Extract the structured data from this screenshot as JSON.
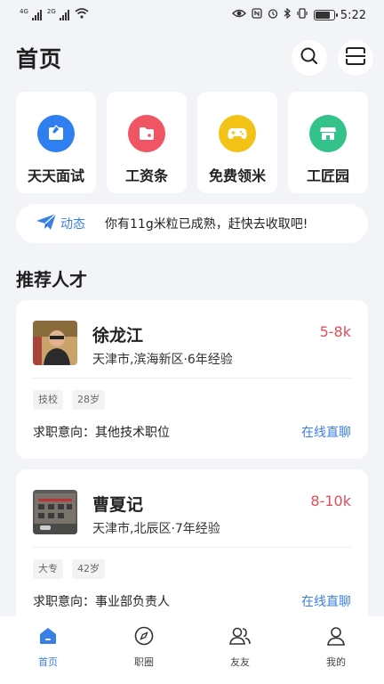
{
  "status_bar": {
    "sim1_tag": "4G",
    "sim2_tag": "2G",
    "time": "5:22",
    "battery_level": 0.8
  },
  "header": {
    "title": "首页"
  },
  "quick_tiles": [
    {
      "label": "天天面试",
      "icon": "interview-icon",
      "color": "#2f7ff0"
    },
    {
      "label": "工资条",
      "icon": "folder-icon",
      "color": "#ef5562"
    },
    {
      "label": "免费领米",
      "icon": "gamepad-icon",
      "color": "#f2c316"
    },
    {
      "label": "工匠园",
      "icon": "store-icon",
      "color": "#33c28a"
    }
  ],
  "notice": {
    "tag": "动态",
    "text": "你有11g米粒已成熟，赶快去收取吧!"
  },
  "section_title": "推荐人才",
  "candidates": [
    {
      "name": "徐龙江",
      "info": "天津市,滨海新区·6年经验",
      "salary": "5-8k",
      "tags": [
        "技校",
        "28岁"
      ],
      "intent": "求职意向：其他技术职位",
      "chat_label": "在线直聊"
    },
    {
      "name": "曹夏记",
      "info": "天津市,北辰区·7年经验",
      "salary": "8-10k",
      "tags": [
        "大专",
        "42岁"
      ],
      "intent": "求职意向：事业部负责人",
      "chat_label": "在线直聊"
    }
  ],
  "tab_bar": [
    {
      "label": "首页",
      "icon": "home-icon",
      "active": true
    },
    {
      "label": "职圈",
      "icon": "compass-icon",
      "active": false
    },
    {
      "label": "友友",
      "icon": "friends-icon",
      "active": false
    },
    {
      "label": "我的",
      "icon": "profile-icon",
      "active": false
    }
  ],
  "colors": {
    "accent": "#3a7fe6",
    "salary": "#e34d59",
    "background": "#f3f4f8"
  }
}
